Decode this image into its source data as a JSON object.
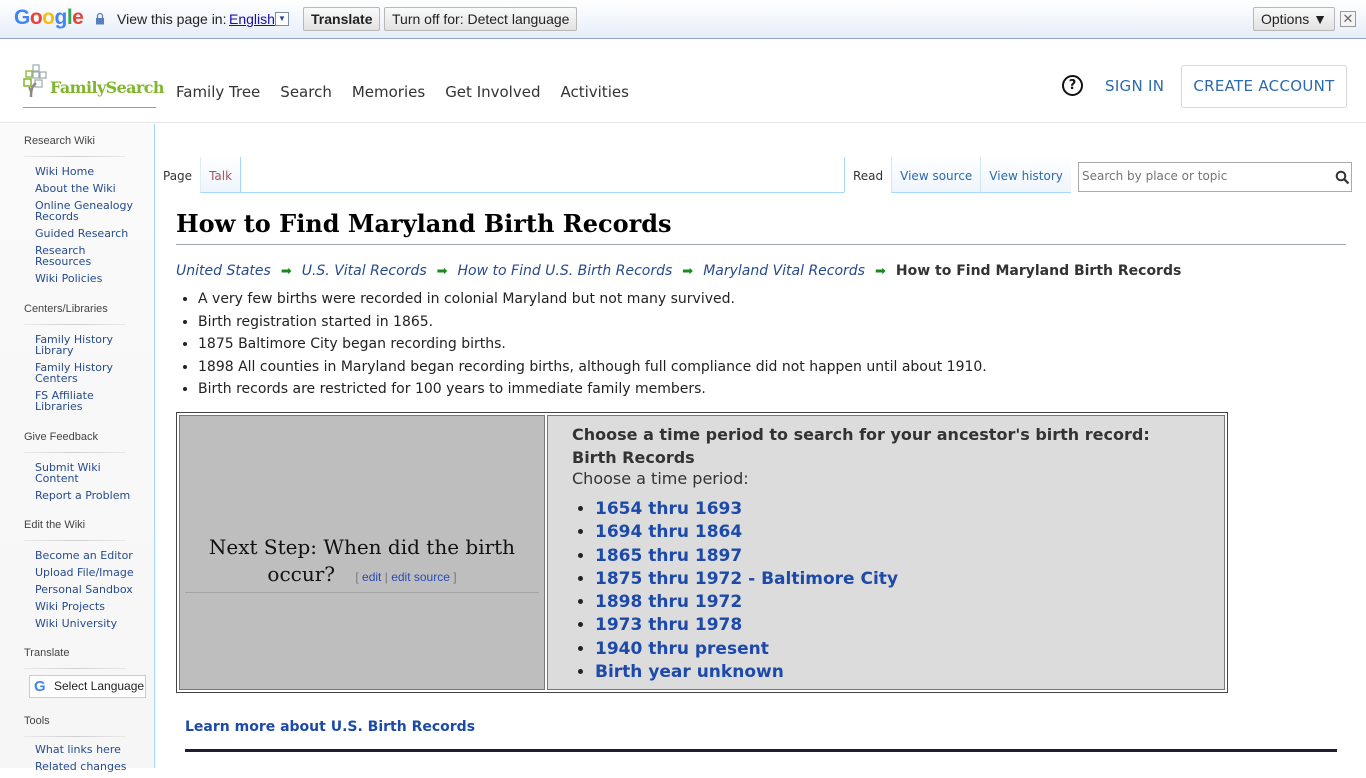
{
  "translate_bar": {
    "logo": [
      "G",
      "o",
      "o",
      "g",
      "l",
      "e"
    ],
    "view_label": "View this page in:",
    "language": "English",
    "translate_button": "Translate",
    "turn_off_button": "Turn off for: Detect language",
    "options_button": "Options ▼",
    "close": "✕"
  },
  "header": {
    "logo_text": "FamilySearch",
    "nav": [
      "Family Tree",
      "Search",
      "Memories",
      "Get Involved",
      "Activities"
    ],
    "help": "?",
    "sign_in": "SIGN IN",
    "create_account": "CREATE ACCOUNT"
  },
  "sidebar": {
    "sections": [
      {
        "heading": "Research Wiki",
        "items": [
          "Wiki Home",
          "About the Wiki",
          "Online Genealogy Records",
          "Guided Research",
          "Research Resources",
          "Wiki Policies"
        ]
      },
      {
        "heading": "Centers/Libraries",
        "items": [
          "Family History Library",
          "Family History Centers",
          "FS Affiliate Libraries"
        ]
      },
      {
        "heading": "Give Feedback",
        "items": [
          "Submit Wiki Content",
          "Report a Problem"
        ]
      },
      {
        "heading": "Edit the Wiki",
        "items": [
          "Become an Editor",
          "Upload File/Image",
          "Personal Sandbox",
          "Wiki Projects",
          "Wiki University"
        ]
      },
      {
        "heading": "Translate",
        "items": []
      },
      {
        "heading": "Tools",
        "items": [
          "What links here",
          "Related changes"
        ]
      }
    ],
    "translate_widget": "Select Language"
  },
  "tabs": {
    "left": [
      "Page",
      "Talk"
    ],
    "right": [
      "Read",
      "View source",
      "View history"
    ],
    "search_placeholder": "Search by place or topic"
  },
  "page": {
    "title": "How to Find Maryland Birth Records",
    "breadcrumbs": [
      "United States",
      "U.S. Vital Records",
      "How to Find U.S. Birth Records",
      "Maryland Vital Records"
    ],
    "breadcrumb_current": "How to Find Maryland Birth Records",
    "facts": [
      "A very few births were recorded in colonial Maryland but not many survived.",
      "Birth registration started in 1865.",
      "1875 Baltimore City began recording births.",
      "1898 All counties in Maryland began recording births, although full compliance did not happen until about 1910.",
      "Birth records are restricted for 100 years to immediate family members."
    ],
    "next_step_line1": "Next Step: When did the birth",
    "next_step_line2": "occur?",
    "edit": "edit",
    "edit_source": "edit source",
    "choose_heading": "Choose a time period to search for your ancestor's birth record:",
    "choose_subheading": "Birth Records",
    "choose_prompt": "Choose a time period:",
    "periods": [
      "1654 thru 1693",
      "1694 thru 1864",
      "1865 thru 1897",
      "1875 thru 1972 - Baltimore City",
      "1898 thru 1972",
      "1973 thru 1978",
      "1940 thru present",
      "Birth year unknown"
    ],
    "learn_more": "Learn more about U.S. Birth Records"
  }
}
